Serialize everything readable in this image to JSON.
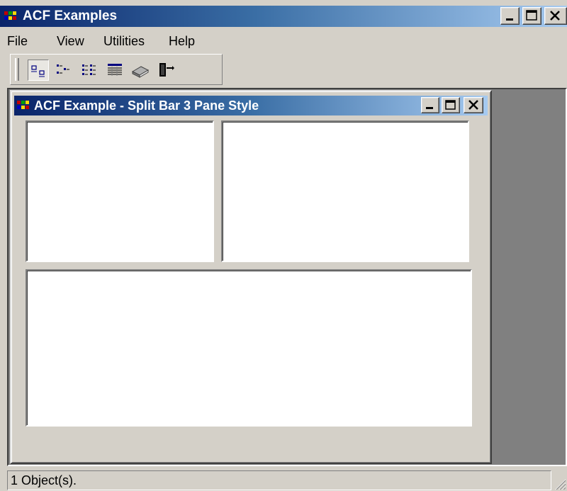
{
  "app": {
    "title": "ACF Examples",
    "icon": "app-grid-icon"
  },
  "window_controls": [
    "minimize-icon",
    "maximize-icon",
    "close-icon"
  ],
  "menu": {
    "items": [
      {
        "label": "File"
      },
      {
        "label": "View"
      },
      {
        "label": "Utilities"
      },
      {
        "label": "Help"
      }
    ]
  },
  "toolbar": {
    "buttons": [
      {
        "icon": "large-icons-view-icon",
        "pressed": true
      },
      {
        "icon": "small-icons-view-icon",
        "pressed": false
      },
      {
        "icon": "list-view-icon",
        "pressed": false
      },
      {
        "icon": "details-view-icon",
        "pressed": false
      },
      {
        "icon": "book-icon",
        "pressed": false
      },
      {
        "icon": "exit-door-icon",
        "pressed": false
      }
    ]
  },
  "child_window": {
    "title": "ACF Example - Split Bar 3 Pane Style",
    "panes": [
      "top-left",
      "top-right",
      "bottom"
    ]
  },
  "status": {
    "text": "1 Object(s)."
  },
  "colors": {
    "title_start": "#0a246a",
    "title_end": "#a6caf0",
    "face": "#d4d0c8",
    "mdi_background": "#808080"
  }
}
